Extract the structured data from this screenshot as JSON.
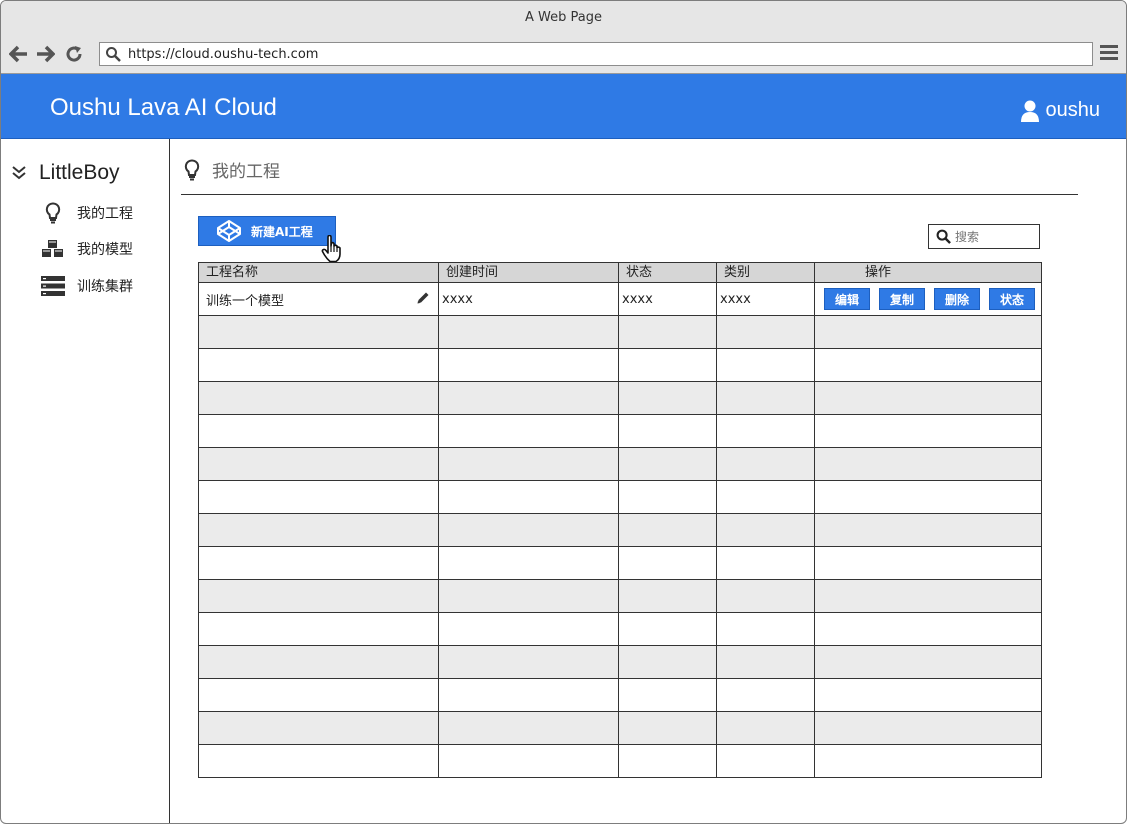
{
  "window": {
    "title": "A Web Page"
  },
  "browser": {
    "url": "https://cloud.oushu-tech.com"
  },
  "header": {
    "brand": "Oushu Lava AI Cloud",
    "username": "oushu"
  },
  "sidebar": {
    "team": "LittleBoy",
    "items": [
      {
        "label": "我的工程",
        "icon": "lightbulb-icon"
      },
      {
        "label": "我的模型",
        "icon": "cubes-icon"
      },
      {
        "label": "训练集群",
        "icon": "server-icon"
      }
    ]
  },
  "main": {
    "title": "我的工程",
    "new_button": "新建AI工程",
    "search_placeholder": "搜索",
    "table": {
      "columns": [
        "工程名称",
        "创建时间",
        "状态",
        "类别",
        "操作"
      ],
      "rows": [
        {
          "name": "训练一个模型",
          "created": "xxxx",
          "status": "xxxx",
          "category": "xxxx"
        }
      ],
      "actions": [
        "编辑",
        "复制",
        "删除",
        "状态"
      ]
    }
  },
  "colors": {
    "accent": "#2f7ae5",
    "header_bg": "#2f7ae5",
    "row_alt": "#ebebeb",
    "table_header": "#d6d6d6"
  }
}
